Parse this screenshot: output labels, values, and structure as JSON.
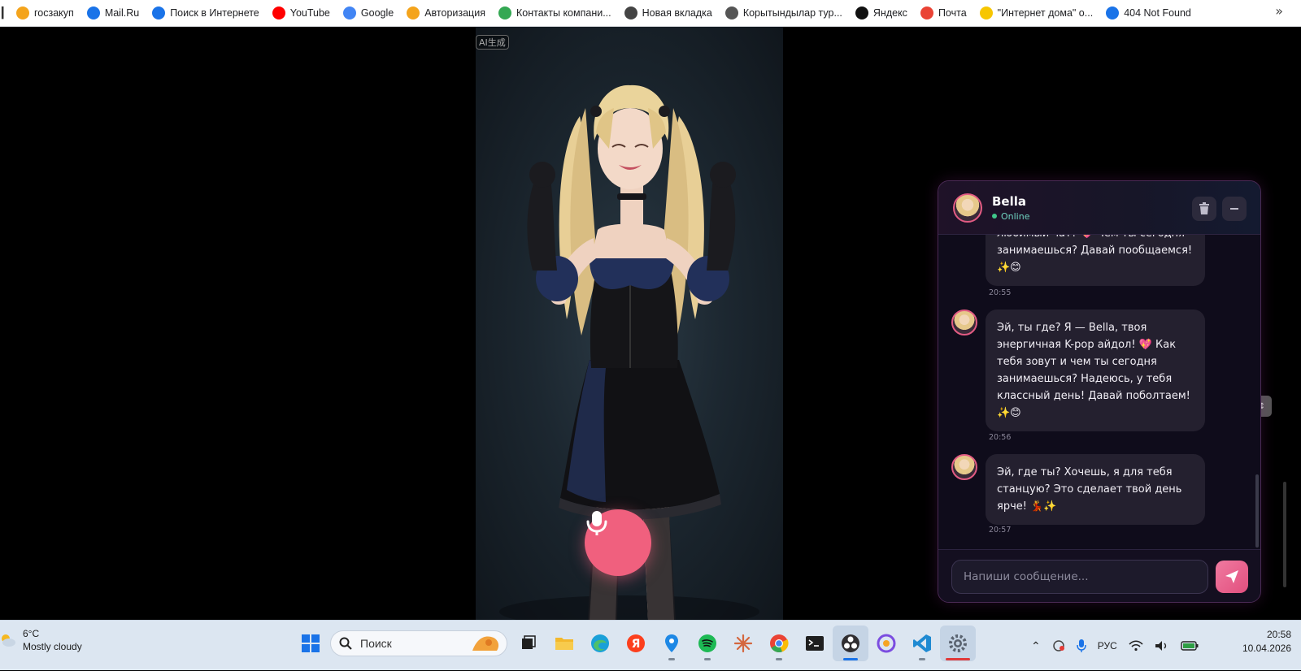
{
  "bookmarks": [
    {
      "label": "госзакуп",
      "icon": "zakup-icon",
      "color": "#f4a41c"
    },
    {
      "label": "Mail.Ru",
      "icon": "mailru-icon",
      "color": "#1a73e8"
    },
    {
      "label": "Поиск в Интернете",
      "icon": "mail-search-icon",
      "color": "#1a73e8"
    },
    {
      "label": "YouTube",
      "icon": "youtube-icon",
      "color": "#ff0000"
    },
    {
      "label": "Google",
      "icon": "google-icon",
      "color": "#4285f4"
    },
    {
      "label": "Авторизация",
      "icon": "zakup-icon",
      "color": "#f4a41c"
    },
    {
      "label": "Контакты компани...",
      "icon": "chart-icon",
      "color": "#34a853"
    },
    {
      "label": "Новая вкладка",
      "icon": "chrome-icon",
      "color": "#444444"
    },
    {
      "label": "Корытындылар тур...",
      "icon": "globe-icon",
      "color": "#555555"
    },
    {
      "label": "Яндекс",
      "icon": "plus-icon",
      "color": "#111111"
    },
    {
      "label": "Почта",
      "icon": "gmail-icon",
      "color": "#ea4335"
    },
    {
      "label": "\"Интернет дома\" о...",
      "icon": "beeline-icon",
      "color": "#f7c600"
    },
    {
      "label": "404 Not Found",
      "icon": "mail-at-icon",
      "color": "#1a73e8"
    }
  ],
  "video": {
    "badge": "AI生成"
  },
  "chat": {
    "name": "Bella",
    "status": "Online",
    "input_placeholder": "Напиши сообщение...",
    "messages": [
      {
        "text": "любимый чат? 💖 Чем ты сегодня занимаешься? Давай пообщаемся! ✨😊",
        "time": "20:55"
      },
      {
        "text": "Эй, ты где? Я — Bella, твоя энергичная K-pop айдол! 💖 Как тебя зовут и чем ты сегодня занимаешься? Надеюсь, у тебя классный день! Давай поболтаем! ✨😊",
        "time": "20:56"
      },
      {
        "text": "Эй, где ты? Хочешь, я для тебя станцую? Это сделает твой день ярче! 💃✨",
        "time": "20:57"
      }
    ]
  },
  "taskbar": {
    "weather_temp": "6°C",
    "weather_desc": "Mostly cloudy",
    "search_label": "Поиск",
    "language": "РУС",
    "time": "20:58",
    "date": "10.04.2026"
  }
}
